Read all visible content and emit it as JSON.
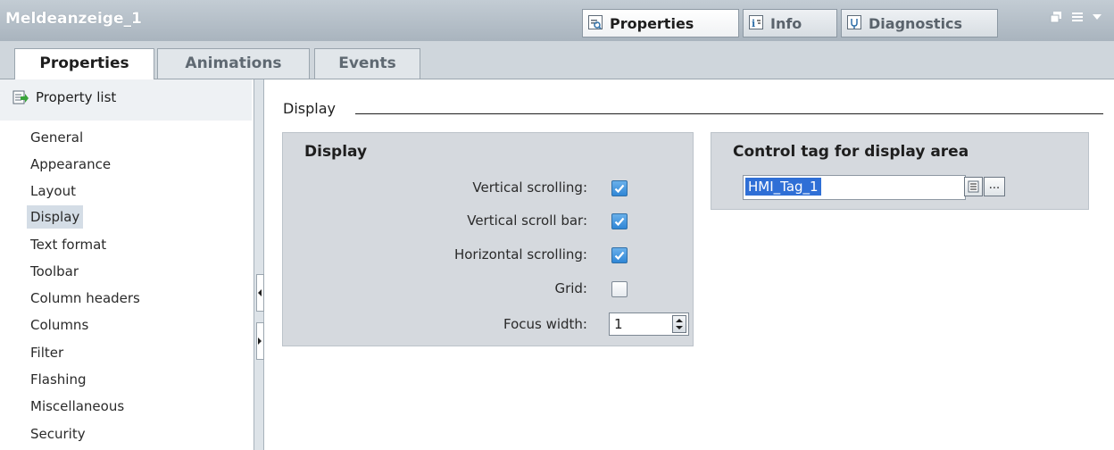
{
  "window": {
    "title": "Meldeanzeige_1",
    "tabs": [
      {
        "label": "Properties",
        "icon": "properties-icon",
        "active": true
      },
      {
        "label": "Info",
        "icon": "info-icon",
        "active": false
      },
      {
        "label": "Diagnostics",
        "icon": "diagnostics-icon",
        "active": false
      }
    ]
  },
  "subtabs": [
    {
      "label": "Properties",
      "active": true
    },
    {
      "label": "Animations",
      "active": false
    },
    {
      "label": "Events",
      "active": false
    }
  ],
  "nav": {
    "header": "Property list",
    "items": [
      "General",
      "Appearance",
      "Layout",
      "Display",
      "Text format",
      "Toolbar",
      "Column headers",
      "Columns",
      "Filter",
      "Flashing",
      "Miscellaneous",
      "Security"
    ],
    "selected": "Display"
  },
  "section": {
    "title": "Display"
  },
  "display_group": {
    "title": "Display",
    "vertical_scrolling": {
      "label": "Vertical scrolling:",
      "checked": true
    },
    "vertical_scroll_bar": {
      "label": "Vertical scroll bar:",
      "checked": true
    },
    "horizontal_scrolling": {
      "label": "Horizontal scrolling:",
      "checked": true
    },
    "grid": {
      "label": "Grid:",
      "checked": false
    },
    "focus_width": {
      "label": "Focus width:",
      "value": "1"
    }
  },
  "control_tag_group": {
    "title": "Control tag for display area",
    "tag_value": "HMI_Tag_1",
    "browse_label": "..."
  },
  "colors": {
    "accent": "#2f86d6",
    "selection": "#2f6fd6",
    "nav_selected": "#d4dde6"
  }
}
